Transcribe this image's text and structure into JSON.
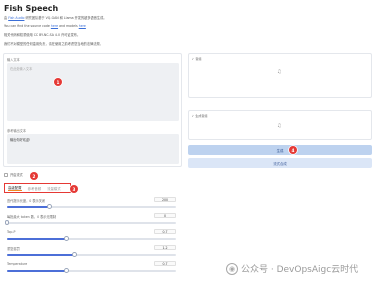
{
  "app": {
    "title": "Fish Speech"
  },
  "description": {
    "line1_prefix": "由",
    "line1_link": "Fish Audio",
    "line1_suffix": "研究团队基于 VQ-GAN 和 Llama 开发的超多语音生成。",
    "line2_prefix": "You can find the source code",
    "line2_link1": "here",
    "line2_mid": "and models",
    "line2_link2": "here",
    "line3": "相关代码和权重使用 CC BY-NC-SA 4.0 许可证发布。",
    "line4": "我们不对模型的任何滥用负责，请在使用之前考虑您当地的法律法规。"
  },
  "input_panel": {
    "label": "输入文本",
    "placeholder": "在此处输入文本",
    "ref_label": "参考输出文本",
    "ref_value": "输出你好欢迎!"
  },
  "badges": {
    "b1": "1",
    "b2": "2",
    "b3": "3",
    "b4": "4"
  },
  "audio_panels": {
    "ref_audio_label": "音频",
    "gen_audio_label": "生成音频"
  },
  "buttons": {
    "generate": "生成",
    "stream_generate": "流式合成"
  },
  "toggle": {
    "label": "开启流式"
  },
  "tabs": [
    {
      "label": "高级配置",
      "active": true
    },
    {
      "label": "参考音频",
      "active": false
    },
    {
      "label": "流量模式",
      "active": false
    }
  ],
  "params": [
    {
      "label": "迭代提示长度，0 表示关闭",
      "value": "200",
      "fraction": 0.25
    },
    {
      "label": "每批最大 token 数，0 表示无限制",
      "value": "0",
      "fraction": 0.0
    },
    {
      "label": "Top-P",
      "value": "0.7",
      "fraction": 0.35
    },
    {
      "label": "重复惩罚",
      "value": "1.2",
      "fraction": 0.4
    },
    {
      "label": "Temperature",
      "value": "0.7",
      "fraction": 0.35
    }
  ],
  "watermark": {
    "text": "公众号 · DevOpsAigc云时代",
    "icon": "wechat-icon"
  },
  "colors": {
    "accent": "#4c6fd8",
    "badge": "#e53935",
    "button": "#bdd2ef",
    "tab_underline": "#f08a24"
  }
}
